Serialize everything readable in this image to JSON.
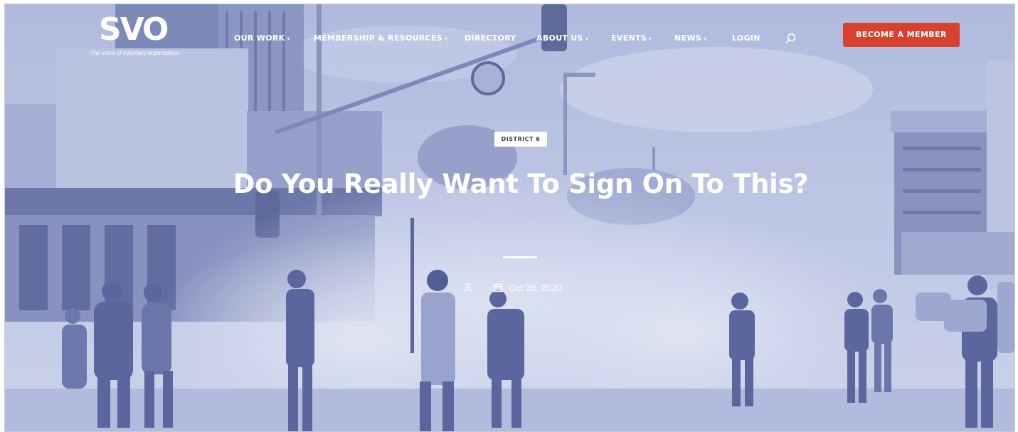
{
  "logo": {
    "mark": "SVO",
    "tagline": "The voice of voluntary organisations"
  },
  "nav": {
    "items": [
      {
        "label": "OUR WORK",
        "caret": "▾"
      },
      {
        "label": "MEMBERSHIP & RESOURCES",
        "caret": "▾"
      },
      {
        "label": "DIRECTORY",
        "caret": ""
      },
      {
        "label": "ABOUT US",
        "caret": "▾"
      },
      {
        "label": "EVENTS",
        "caret": "▾"
      },
      {
        "label": "NEWS",
        "caret": "▾"
      },
      {
        "label": "LOGIN",
        "caret": ""
      }
    ],
    "search_icon": "search-icon"
  },
  "cta": {
    "label": "BECOME A MEMBER"
  },
  "article": {
    "category": "DISTRICT 6",
    "title": "Do You Really Want To Sign On To This?",
    "date": "Oct 26, 2020"
  },
  "colors": {
    "accent": "#d9412f",
    "hero_tint": "#8f9ccd"
  }
}
